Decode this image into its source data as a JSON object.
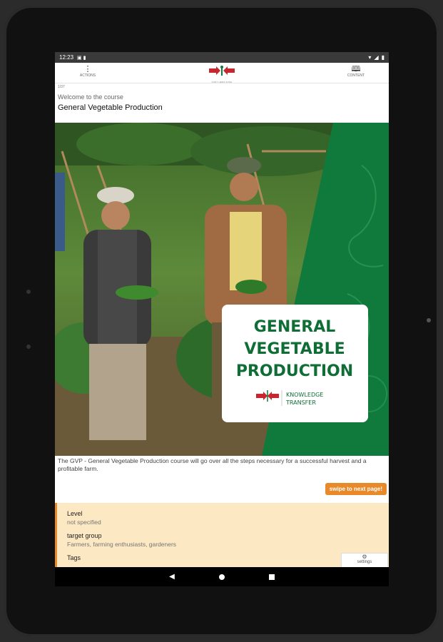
{
  "status": {
    "time": "12:23"
  },
  "appbar": {
    "actions_label": "ACTIONS",
    "logo_caption": "KURT HERZ ANSH",
    "content_label": "CONTENT"
  },
  "page": {
    "number": "1/37"
  },
  "course": {
    "welcome": "Welcome to the course",
    "title": "General Vegetable Production",
    "cover": {
      "title_line1": "GENERAL",
      "title_line2": "VEGETABLE",
      "title_line3": "PRODUCTION",
      "brand_line1": "KNOWLEDGE",
      "brand_line2": "TRANSFER"
    },
    "description": "The GVP - General Vegetable Production course will go over all the steps necessary for a successful harvest and a profitable farm.",
    "swipe_button": "swipe to next page!"
  },
  "info": [
    {
      "label": "Level",
      "value": "not specified"
    },
    {
      "label": "target group",
      "value": "Farmers, farming enthusiasts, gardeners"
    },
    {
      "label": "Tags",
      "value": ""
    }
  ],
  "settings_label": "settings",
  "colors": {
    "accent": "#e8892a",
    "brand_green": "#0f7a3c",
    "info_bg": "#fce8c3"
  }
}
